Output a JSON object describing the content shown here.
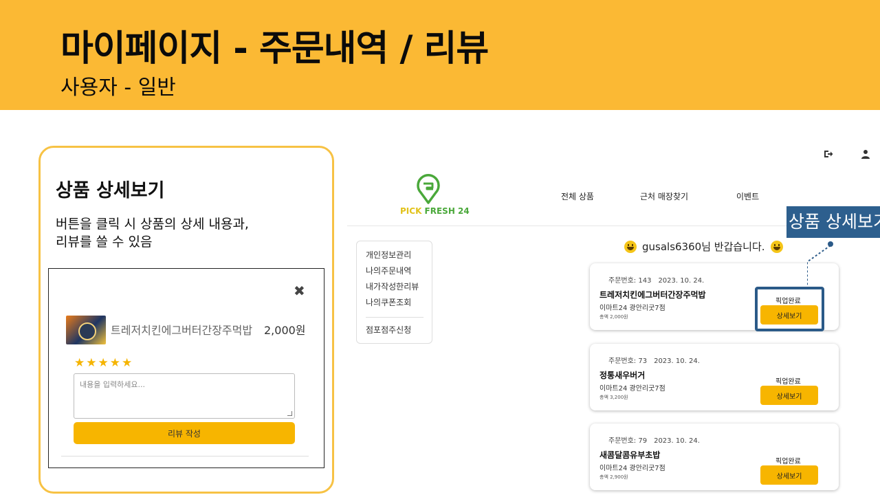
{
  "slide": {
    "title": "마이페이지 - 주문내역 / 리뷰",
    "subtitle": "사용자 - 일반"
  },
  "callout": {
    "title": "상품 상세보기",
    "desc_lines": [
      "버튼을 클릭 시 상품의 상세 내용과,",
      "리뷰를 쓸 수 있음"
    ]
  },
  "modal": {
    "close_icon": "close-icon",
    "product_name": "트레저치킨에그버터간장주먹밥",
    "price": "2,000원",
    "stars": "★★★★★",
    "rating": 5,
    "review_placeholder": "내용을 입력하세요...",
    "review_button": "리뷰 작성"
  },
  "header": {
    "logout_icon": "logout-icon",
    "user_icon": "user-icon",
    "logo_text_1": "PICK ",
    "logo_text_2": "FRESH 24",
    "nav": [
      "전체 상품",
      "근처 매장찾기",
      "이벤트"
    ]
  },
  "sidebar": {
    "items": [
      "개인정보관리",
      "나의주문내역",
      "내가작성한리뷰",
      "나의쿠폰조회"
    ],
    "extra": "점포점주신청"
  },
  "welcome": {
    "user": "gusals6360",
    "suffix": "님 반갑습니다."
  },
  "orders": [
    {
      "meta_label": "주문번호: 143",
      "date": "2023. 10. 24.",
      "name": "트레저치킨에그버터간장주먹밥",
      "store": "이마트24 광안리굿7점",
      "total": "총액 2,000원",
      "status": "픽업완료",
      "button": "상세보기"
    },
    {
      "meta_label": "주문번호: 73",
      "date": "2023. 10. 24.",
      "name": "정통새우버거",
      "store": "이마트24 광안리굿7점",
      "total": "총액 3,200원",
      "status": "픽업완료",
      "button": "상세보기"
    },
    {
      "meta_label": "주문번호: 79",
      "date": "2023. 10. 24.",
      "name": "새콤달콤유부초밥",
      "store": "이마트24 광안리굿7점",
      "total": "총액 2,900원",
      "status": "픽업완료",
      "button": "상세보기"
    }
  ],
  "annotation": {
    "label": "상품 상세보기"
  },
  "colors": {
    "banner": "#FBB934",
    "accent_button": "#F7B500",
    "annotation_blue": "#2d5f8e",
    "callout_border": "#F7C244"
  }
}
